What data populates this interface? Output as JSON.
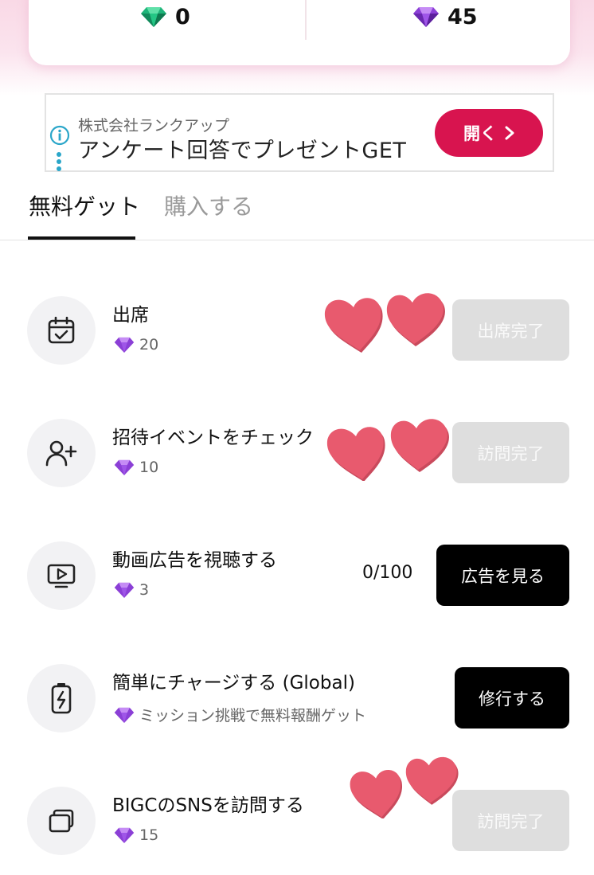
{
  "wallet": {
    "free_gems": "0",
    "paid_gems": "45"
  },
  "ad": {
    "sponsor": "株式会社ランクアップ",
    "headline": "アンケート回答でプレゼントGET",
    "cta_label": "開く"
  },
  "tabs": [
    {
      "label": "無料ゲット",
      "active": true
    },
    {
      "label": "購入する",
      "active": false
    }
  ],
  "missions": [
    {
      "title": "出席",
      "reward": "20",
      "button": "出席完了",
      "button_state": "disabled",
      "icon": "calendar-check-icon"
    },
    {
      "title": "招待イベントをチェック",
      "reward": "10",
      "button": "訪問完了",
      "button_state": "disabled",
      "icon": "add-user-icon"
    },
    {
      "title": "動画広告を視聴する",
      "reward": "3",
      "progress": "0/100",
      "button": "広告を見る",
      "button_state": "active",
      "icon": "video-play-icon"
    },
    {
      "title": "簡単にチャージする (Global)",
      "reward": "ミッション挑戦で無料報酬ゲット",
      "button": "修行する",
      "button_state": "active",
      "icon": "battery-charge-icon"
    },
    {
      "title": "BIGCのSNSを訪問する",
      "reward": "15",
      "button": "訪問完了",
      "button_state": "disabled",
      "icon": "windows-stack-icon"
    }
  ],
  "colors": {
    "accent_pink": "#d8144f",
    "heart": "#e85a6e",
    "disabled_button": "#dedede"
  }
}
